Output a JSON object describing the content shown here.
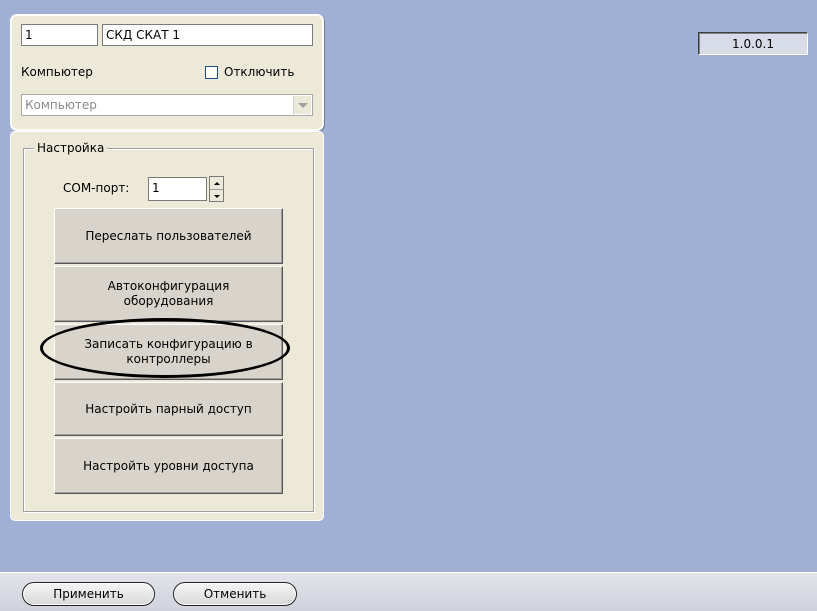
{
  "object": {
    "id_value": "1",
    "name_value": "СКД СКАТ 1",
    "computer_label": "Компьютер",
    "disable_label": "Отключить",
    "disable_checked": false,
    "computer_select_value": "Компьютер"
  },
  "settings": {
    "group_title": "Настройка",
    "com_port_label": "COM-порт:",
    "com_port_value": "1",
    "buttons": [
      "Переслать пользователей",
      "Автоконфигурация оборудования",
      "Записать конфигурацию в контроллеры",
      "Настройть парный доступ",
      "Настройть уровни доступа"
    ]
  },
  "version": "1.0.0.1",
  "footer": {
    "apply_label": "Применить",
    "cancel_label": "Отменить"
  }
}
